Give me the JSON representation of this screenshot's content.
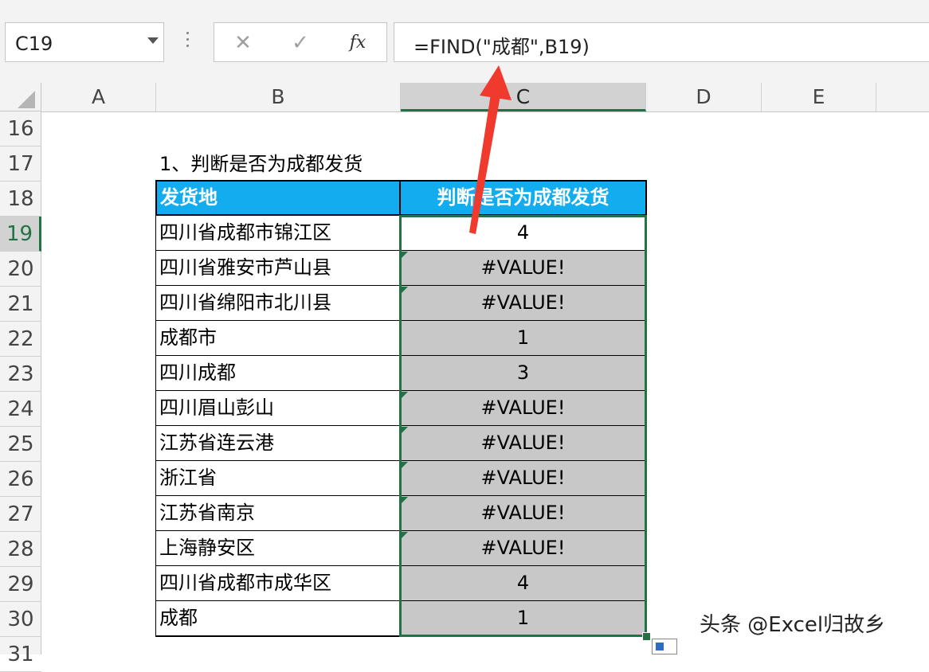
{
  "name_box": {
    "value": "C19"
  },
  "formula_bar": {
    "cancel_symbol": "✕",
    "confirm_symbol": "✓",
    "fx_label": "fx",
    "formula": "=FIND(\"成都\",B19)"
  },
  "columns": [
    "A",
    "B",
    "C",
    "D",
    "E"
  ],
  "active_column": "C",
  "rows": [
    "16",
    "17",
    "18",
    "19",
    "20",
    "21",
    "22",
    "23",
    "24",
    "25",
    "26",
    "27",
    "28",
    "29",
    "30",
    "31"
  ],
  "active_row": "19",
  "sheet": {
    "note": "1、判断是否为成都发货",
    "table": {
      "headers": [
        "发货地",
        "判断是否为成都发货"
      ],
      "rows": [
        {
          "location": "四川省成都市锦江区",
          "result": "4"
        },
        {
          "location": "四川省雅安市芦山县",
          "result": "#VALUE!"
        },
        {
          "location": "四川省绵阳市北川县",
          "result": "#VALUE!"
        },
        {
          "location": "成都市",
          "result": "1"
        },
        {
          "location": "四川成都",
          "result": "3"
        },
        {
          "location": "四川眉山彭山",
          "result": "#VALUE!"
        },
        {
          "location": "江苏省连云港",
          "result": "#VALUE!"
        },
        {
          "location": "浙江省",
          "result": "#VALUE!"
        },
        {
          "location": "江苏省南京",
          "result": "#VALUE!"
        },
        {
          "location": "上海静安区",
          "result": "#VALUE!"
        },
        {
          "location": "四川省成都市成华区",
          "result": "4"
        },
        {
          "location": "成都",
          "result": "1"
        }
      ]
    }
  },
  "colors": {
    "header_fill": "#13adef",
    "selection": "#217346",
    "annotation_arrow": "#f03a2e",
    "result_fill": "#c8c8c8"
  },
  "watermark": "头条 @Excel归故乡"
}
